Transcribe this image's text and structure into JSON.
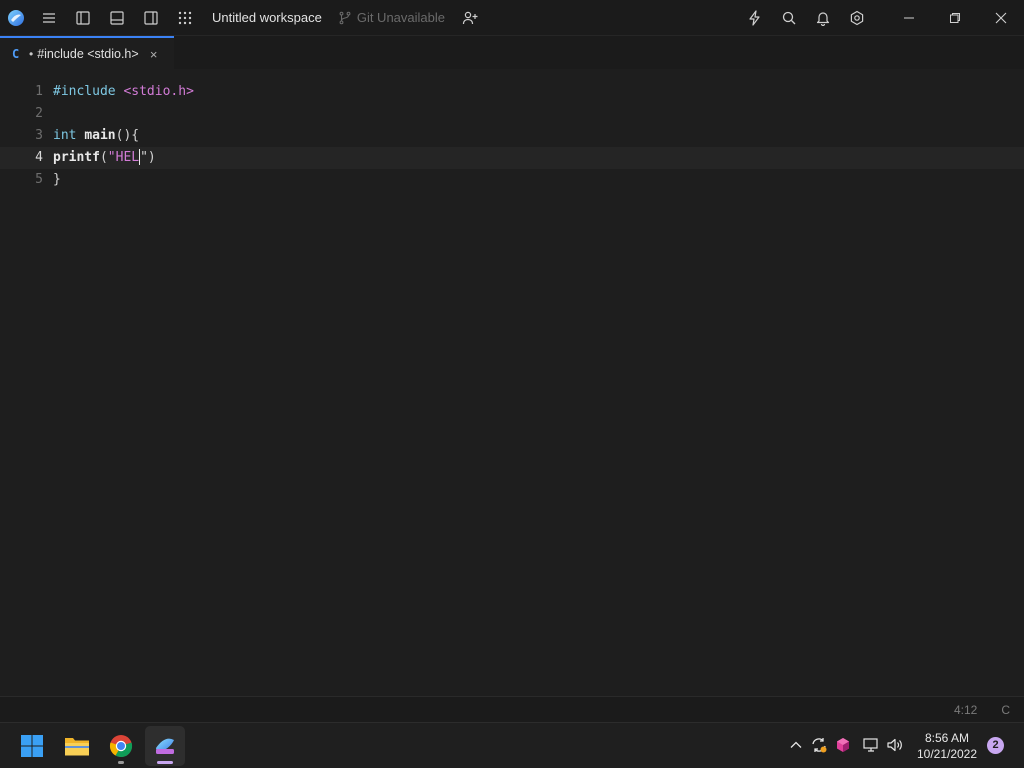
{
  "titlebar": {
    "workspace_title": "Untitled workspace",
    "git_status": "Git Unavailable",
    "icons": [
      "app-logo",
      "menu-icon",
      "toggle-left-panel-icon",
      "toggle-bottom-panel-icon",
      "toggle-right-panel-icon",
      "apps-grid-icon",
      "git-branch-icon",
      "add-person-icon",
      "lightning-icon",
      "search-icon",
      "bell-icon",
      "settings-icon",
      "minimize-icon",
      "restore-icon",
      "close-icon"
    ]
  },
  "tabs": [
    {
      "lang": "C",
      "modified_dot": "•",
      "title": "#include <stdio.h>",
      "close": "×",
      "active": true
    }
  ],
  "editor": {
    "current_line": 4,
    "lines": [
      {
        "number": "1",
        "tokens": [
          {
            "t": "#include",
            "c": "t-inc"
          },
          {
            "t": " ",
            "c": "t-plain"
          },
          {
            "t": "<stdio.h>",
            "c": "t-hdr"
          }
        ]
      },
      {
        "number": "2",
        "tokens": []
      },
      {
        "number": "3",
        "tokens": [
          {
            "t": "int",
            "c": "t-kw"
          },
          {
            "t": " ",
            "c": "t-plain"
          },
          {
            "t": "main",
            "c": "t-bold"
          },
          {
            "t": "(){",
            "c": "t-plain"
          }
        ]
      },
      {
        "number": "4",
        "tokens": [
          {
            "t": "printf",
            "c": "t-bold"
          },
          {
            "t": "(",
            "c": "t-plain"
          },
          {
            "t": "\"HEL",
            "c": "t-str"
          },
          {
            "t": "|caret|",
            "c": "caret"
          },
          {
            "t": "\")",
            "c": "t-plain"
          }
        ]
      },
      {
        "number": "5",
        "tokens": [
          {
            "t": "}",
            "c": "t-plain"
          }
        ]
      }
    ]
  },
  "statusbar": {
    "cursor_position": "4:12",
    "language": "C"
  },
  "taskbar": {
    "apps": [
      {
        "name": "start-button"
      },
      {
        "name": "file-explorer"
      },
      {
        "name": "chrome"
      },
      {
        "name": "code-editor",
        "active": true
      }
    ],
    "clock": {
      "time": "8:56 AM",
      "date": "10/21/2022"
    },
    "notification_count": "2"
  },
  "colors": {
    "accent": "#3b82f6",
    "background": "#1e1e1e",
    "keyword": "#7ec8e3",
    "string": "#d27bd6"
  }
}
